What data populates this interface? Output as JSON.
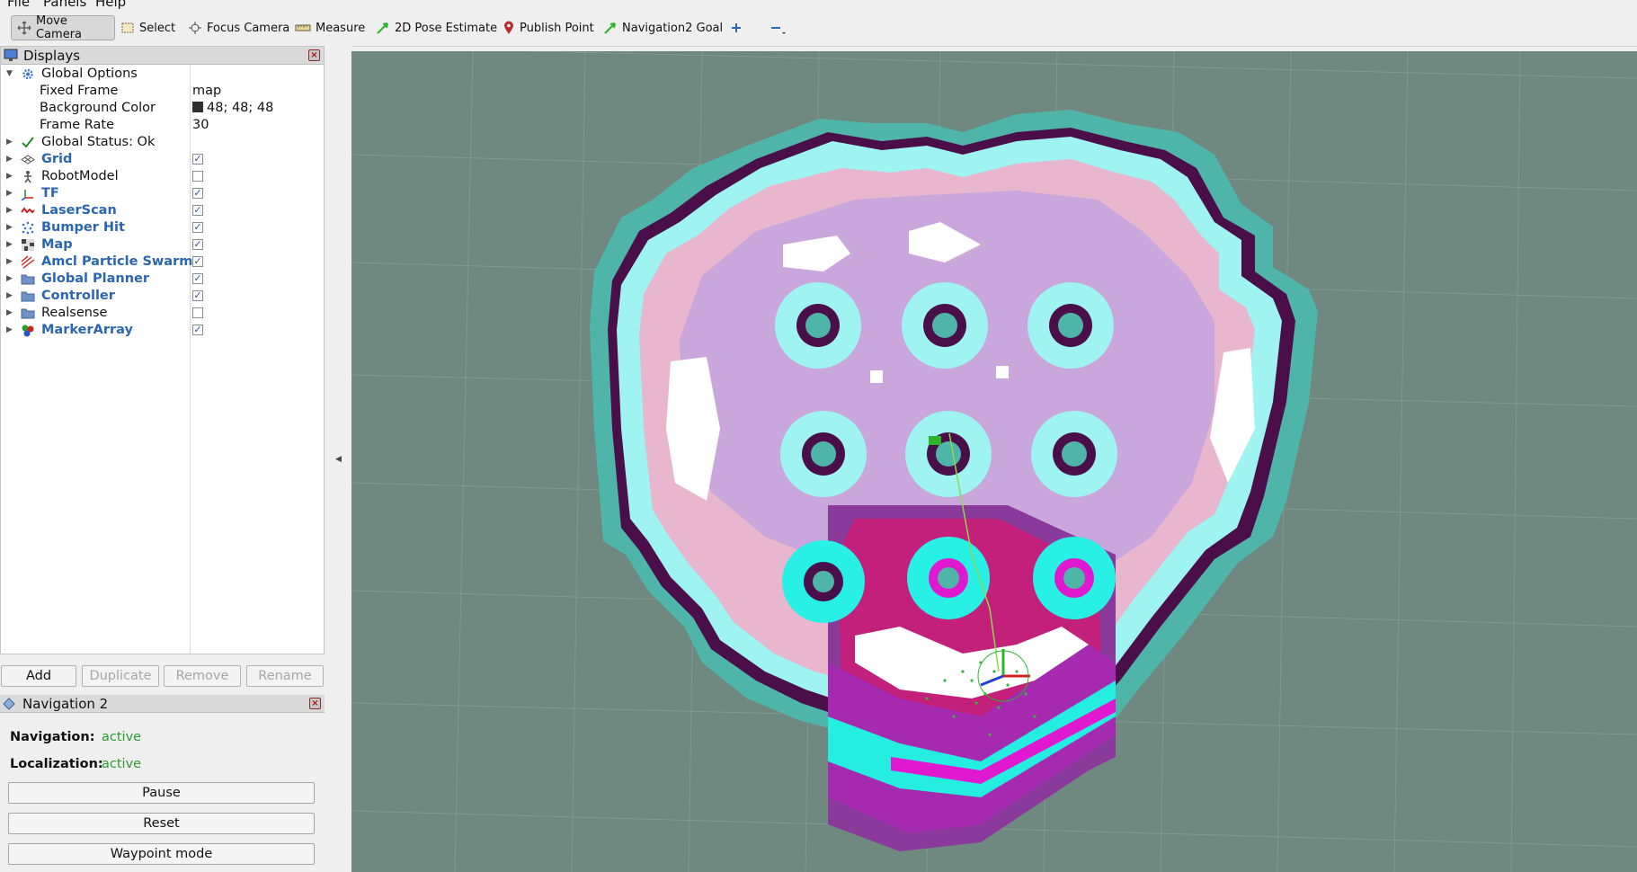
{
  "menu": {
    "file": "File",
    "panels": "Panels",
    "help": "Help"
  },
  "toolbar": {
    "move_camera": "Move Camera",
    "select": "Select",
    "focus_camera": "Focus Camera",
    "measure": "Measure",
    "pose_estimate": "2D Pose Estimate",
    "publish_point": "Publish Point",
    "nav_goal": "Navigation2 Goal"
  },
  "displays": {
    "title": "Displays",
    "global_options": "Global Options",
    "fixed_frame_label": "Fixed Frame",
    "fixed_frame_value": "map",
    "bg_color_label": "Background Color",
    "bg_color_value": "48; 48; 48",
    "frame_rate_label": "Frame Rate",
    "frame_rate_value": "30",
    "global_status": "Global Status: Ok",
    "items": [
      {
        "label": "Grid",
        "checked": true
      },
      {
        "label": "RobotModel",
        "checked": false
      },
      {
        "label": "TF",
        "checked": true
      },
      {
        "label": "LaserScan",
        "checked": true
      },
      {
        "label": "Bumper Hit",
        "checked": true
      },
      {
        "label": "Map",
        "checked": true
      },
      {
        "label": "Amcl Particle Swarm",
        "checked": true
      },
      {
        "label": "Global Planner",
        "checked": true
      },
      {
        "label": "Controller",
        "checked": true
      },
      {
        "label": "Realsense",
        "checked": false
      },
      {
        "label": "MarkerArray",
        "checked": true
      }
    ]
  },
  "buttons": {
    "add": "Add",
    "duplicate": "Duplicate",
    "remove": "Remove",
    "rename": "Rename"
  },
  "nav2": {
    "title": "Navigation 2",
    "navigation_label": "Navigation:",
    "navigation_value": "active",
    "localization_label": "Localization:",
    "localization_value": "active",
    "pause": "Pause",
    "reset": "Reset",
    "waypoint": "Waypoint mode"
  },
  "colors": {
    "viewport_bg": "#6f8880",
    "status_active": "#2e9b2e",
    "link_blue": "#2b66b1"
  }
}
